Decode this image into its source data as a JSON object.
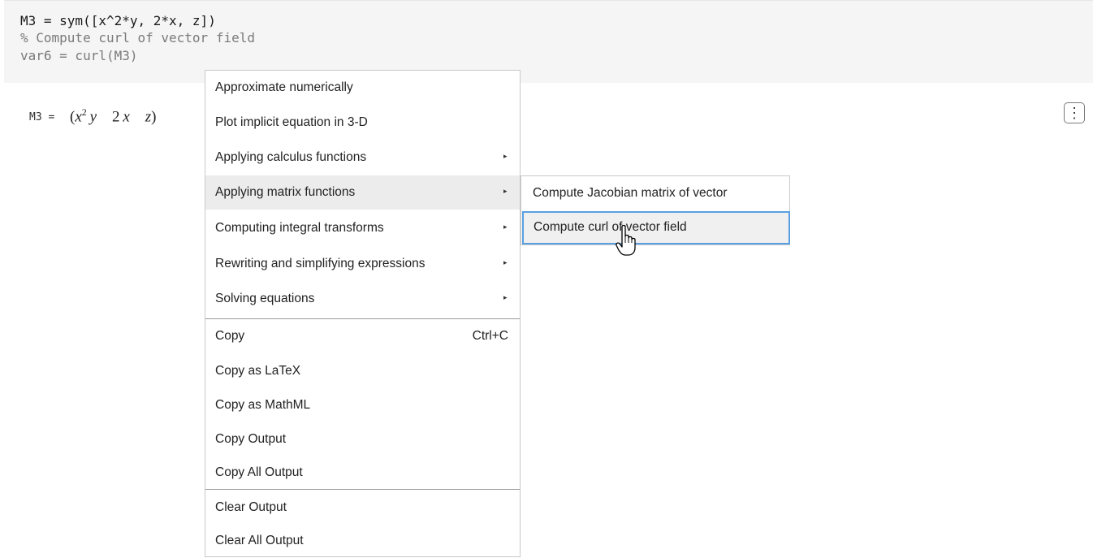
{
  "code": {
    "line1": "M3 = sym([x^2*y, 2*x, z])",
    "line2": "% Compute curl of vector field",
    "line3": "var6 = curl(M3)"
  },
  "output": {
    "lhs": "M3 =",
    "open_paren": "(",
    "x": "x",
    "exponent": "2",
    "y": "y",
    "two": "2",
    "x2": "x",
    "z": "z",
    "close_paren": ")"
  },
  "kebab": {
    "icon": "vertical-ellipsis-icon",
    "glyph": "⋮"
  },
  "context_menu": {
    "items": [
      {
        "label": "Approximate numerically",
        "has_submenu": false
      },
      {
        "label": "Plot implicit equation in 3-D",
        "has_submenu": false
      },
      {
        "label": "Applying calculus functions",
        "has_submenu": true
      },
      {
        "label": "Applying matrix functions",
        "has_submenu": true
      },
      {
        "label": "Computing integral transforms",
        "has_submenu": true
      },
      {
        "label": "Rewriting and simplifying expressions",
        "has_submenu": true
      },
      {
        "label": "Solving equations",
        "has_submenu": true
      },
      {
        "label": "Copy",
        "shortcut": "Ctrl+C"
      },
      {
        "label": "Copy as LaTeX"
      },
      {
        "label": "Copy as MathML"
      },
      {
        "label": "Copy Output"
      },
      {
        "label": "Copy All Output"
      },
      {
        "label": "Clear Output"
      },
      {
        "label": "Clear All Output"
      }
    ],
    "arrow_glyph": "▸",
    "hovered_item": "Applying matrix functions"
  },
  "submenu": {
    "items": [
      {
        "label": "Compute Jacobian matrix of vector"
      },
      {
        "label": "Compute curl of vector field"
      }
    ],
    "selected_item": "Compute curl of vector field",
    "selection_color": "#5aa0e0"
  }
}
